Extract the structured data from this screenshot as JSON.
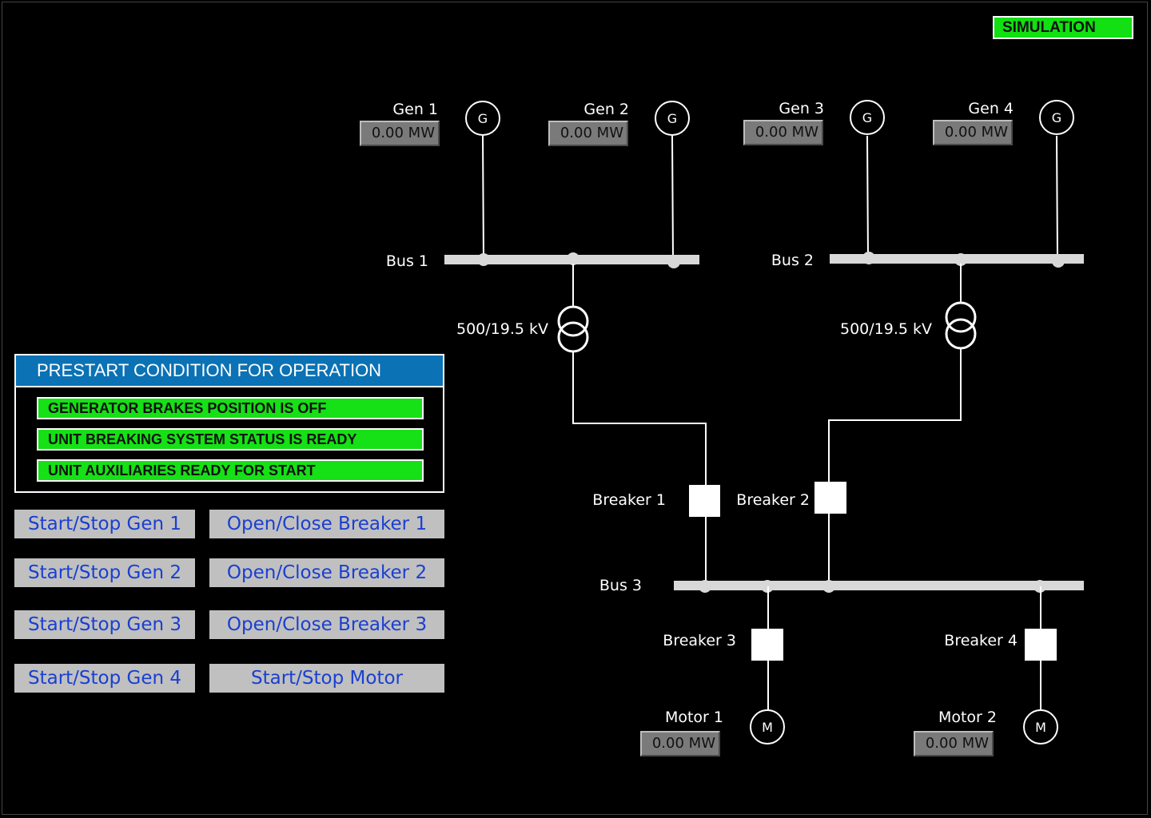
{
  "status": {
    "mode": "SIMULATION",
    "mode_color": "#12e012"
  },
  "generators": [
    {
      "name": "Gen 1",
      "power": "0.00 MW",
      "symbol": "G"
    },
    {
      "name": "Gen 2",
      "power": "0.00 MW",
      "symbol": "G"
    },
    {
      "name": "Gen 3",
      "power": "0.00 MW",
      "symbol": "G"
    },
    {
      "name": "Gen 4",
      "power": "0.00 MW",
      "symbol": "G"
    }
  ],
  "buses": [
    "Bus 1",
    "Bus 2",
    "Bus 3"
  ],
  "transformers": [
    {
      "rating": "500/19.5 kV"
    },
    {
      "rating": "500/19.5 kV"
    }
  ],
  "breakers": [
    "Breaker 1",
    "Breaker 2",
    "Breaker 3",
    "Breaker 4"
  ],
  "motors": [
    {
      "name": "Motor 1",
      "power": "0.00 MW",
      "symbol": "M"
    },
    {
      "name": "Motor 2",
      "power": "0.00 MW",
      "symbol": "M"
    }
  ],
  "prestart": {
    "title": "PRESTART CONDITION FOR OPERATION",
    "title_color": "#0b72b5",
    "ok_color": "#16e016",
    "conditions": [
      "GENERATOR BRAKES POSITION IS OFF",
      "UNIT BREAKING SYSTEM STATUS IS READY",
      "UNIT AUXILIARIES READY FOR START"
    ]
  },
  "controls": {
    "gen1": "Start/Stop Gen 1",
    "gen2": "Start/Stop Gen 2",
    "gen3": "Start/Stop Gen 3",
    "gen4": "Start/Stop Gen 4",
    "breaker1": "Open/Close Breaker 1",
    "breaker2": "Open/Close Breaker 2",
    "breaker3": "Open/Close Breaker 3",
    "motor": "Start/Stop Motor"
  }
}
